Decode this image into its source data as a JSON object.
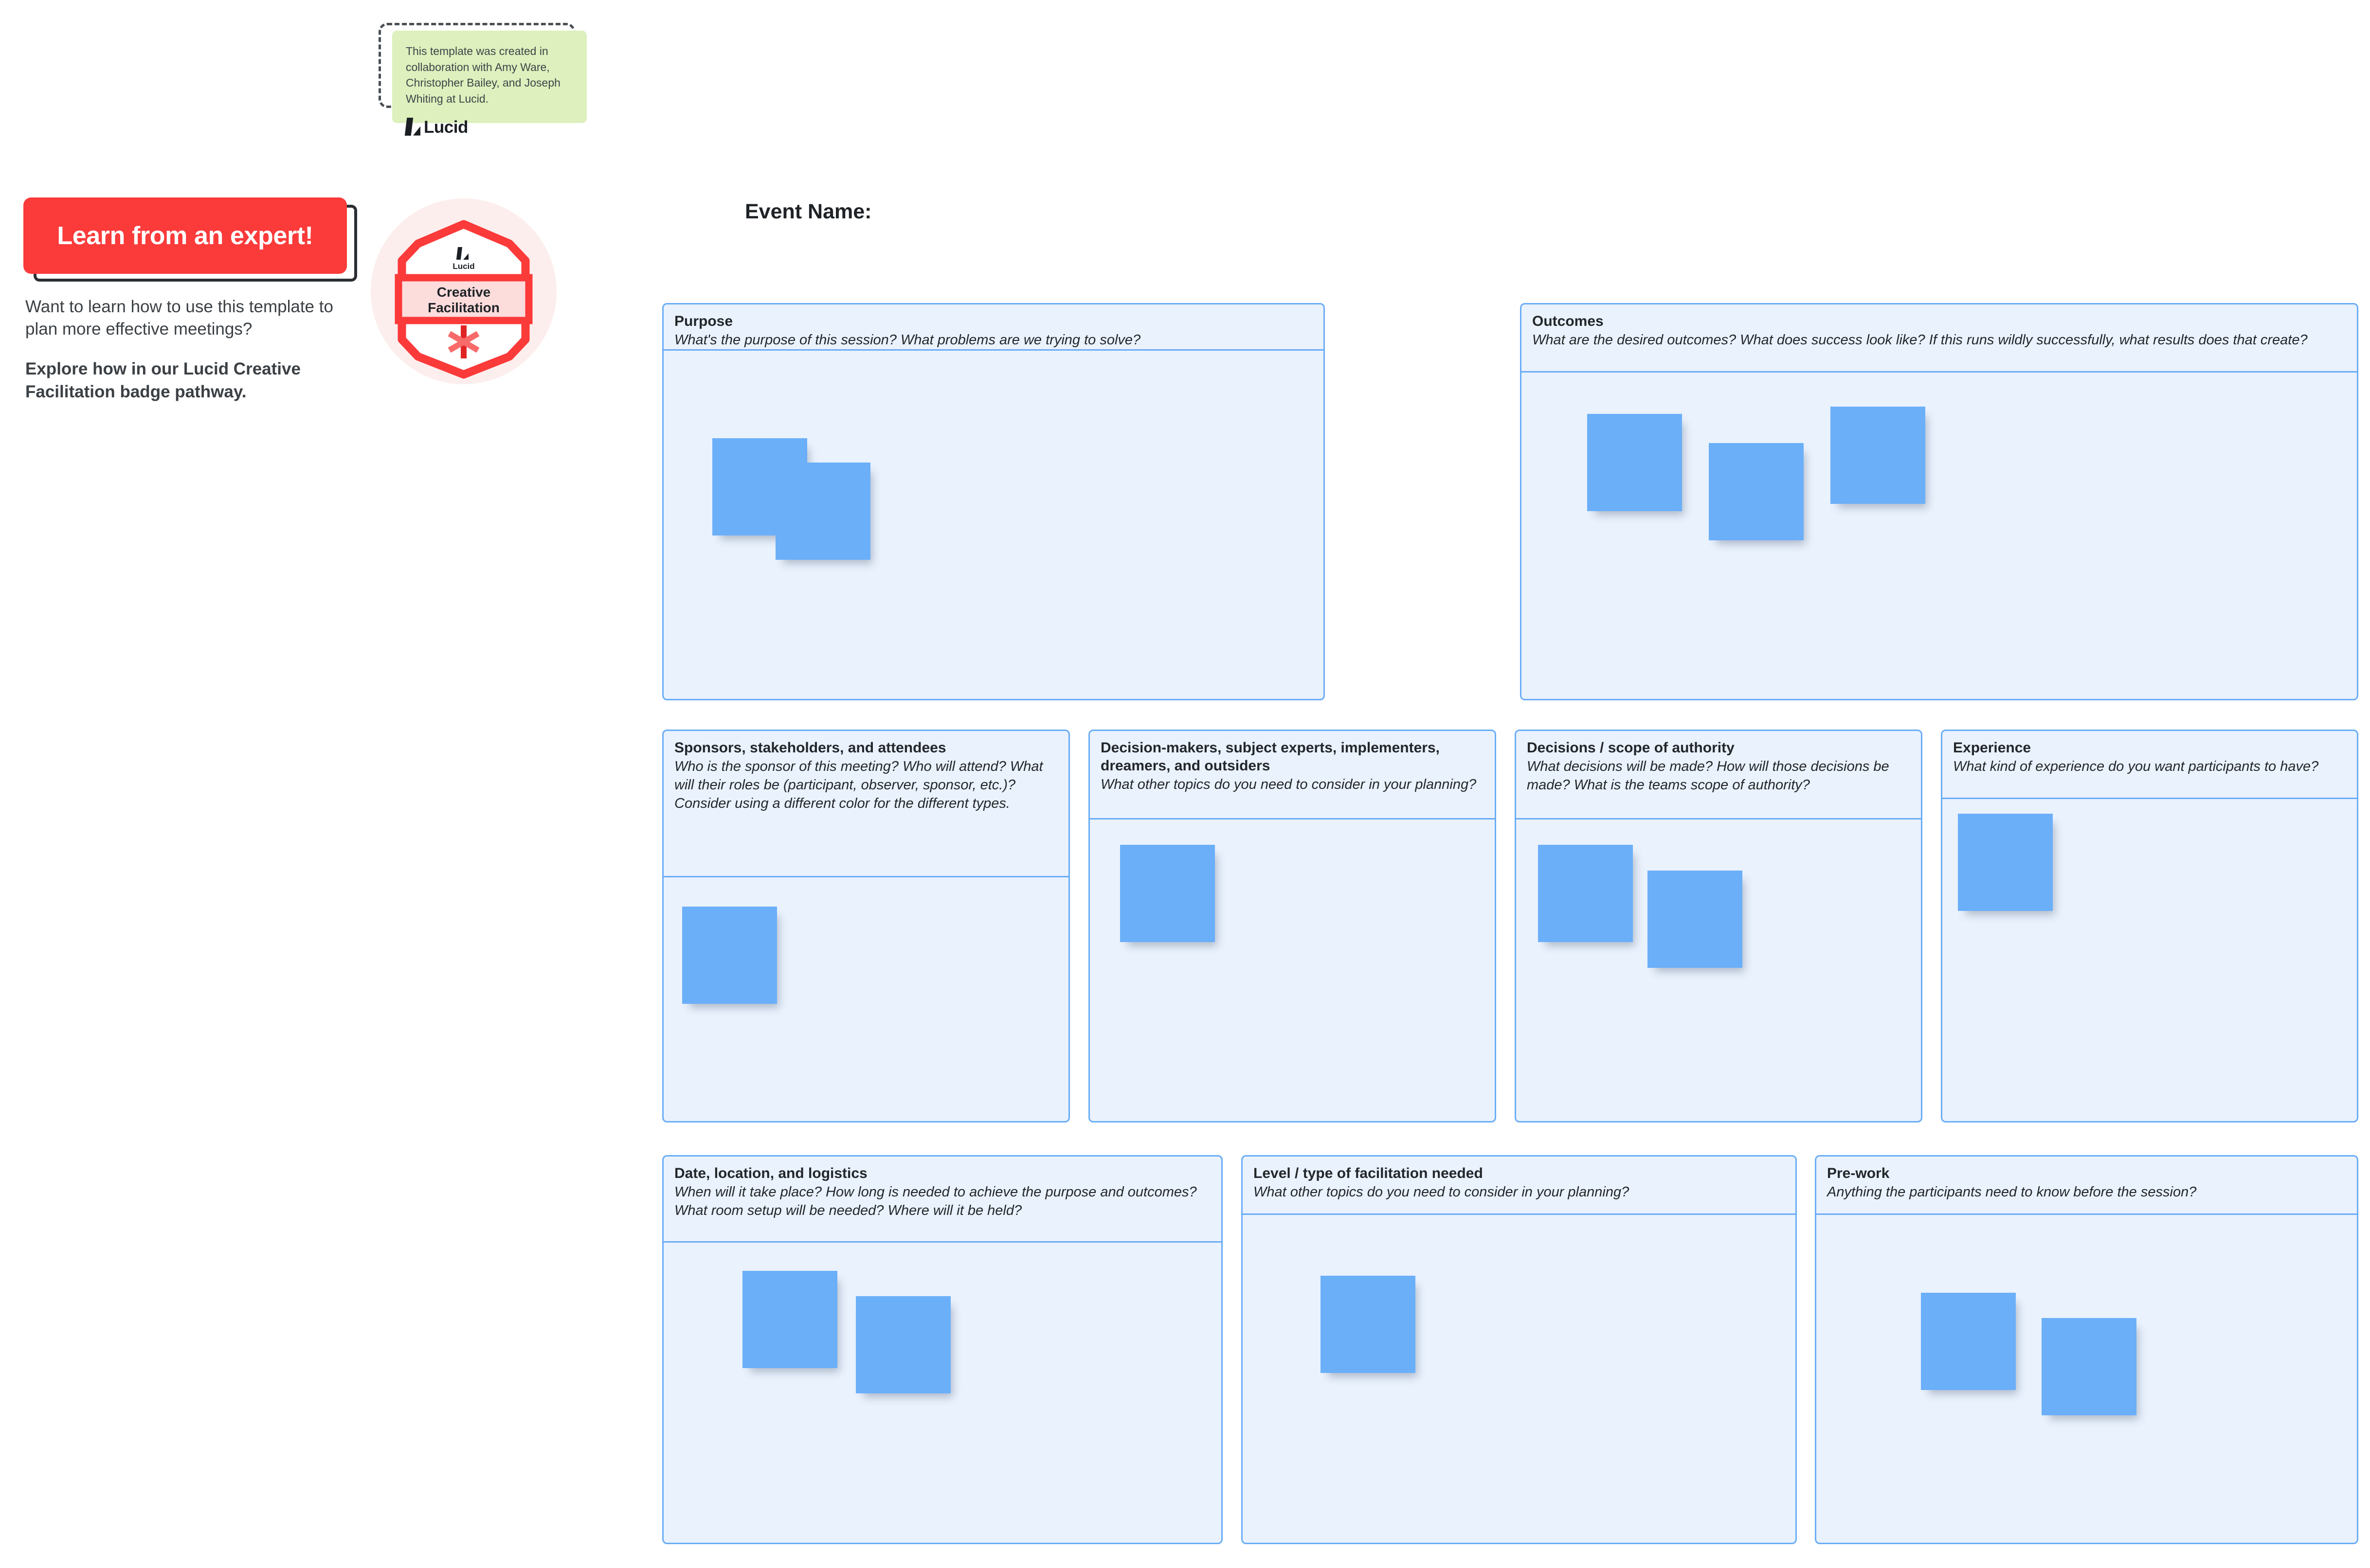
{
  "attribution": {
    "text": "This template was created in collaboration with Amy Ware, Christopher Bailey, and Joseph Whiting at Lucid.",
    "brand": "Lucid"
  },
  "promo": {
    "button_label": "Learn from an expert!",
    "paragraph": "Want to learn how to use this template to plan more effective meetings?",
    "cta": "Explore how in our Lucid Creative Facilitation badge pathway."
  },
  "badge": {
    "brand": "Lucid",
    "line1": "Creative",
    "line2": "Facilitation",
    "colors": {
      "accent": "#FB3A3A",
      "halo": "#FDEEEE",
      "band": "#FDDCDC"
    }
  },
  "board": {
    "title": "Event Name:",
    "colors": {
      "card_fill": "#EAF2FD",
      "card_border": "#6AADF7",
      "sticky": "#6BAFF9"
    },
    "cards": [
      {
        "title": "Purpose",
        "prompt": "What's the purpose of this session? What problems are we trying to solve?",
        "stickies": 2
      },
      {
        "title": "Outcomes",
        "prompt": "What are the desired outcomes? What does success look like? If this runs wildly successfully, what results does that create?",
        "stickies": 3
      },
      {
        "title": "Sponsors, stakeholders, and attendees",
        "prompt": "Who is the sponsor of this meeting? Who will attend? What will their roles be (participant, observer, sponsor, etc.)? Consider using a different color for the different types.",
        "stickies": 1
      },
      {
        "title": "Decision-makers, subject experts, implementers, dreamers, and outsiders",
        "prompt": "What other topics do you need to consider in your planning?",
        "stickies": 1
      },
      {
        "title": "Decisions / scope of authority",
        "prompt": "What decisions will be made? How will those decisions be made? What is the teams scope of authority?",
        "stickies": 2
      },
      {
        "title": "Experience",
        "prompt": "What kind of experience do you want participants to have?",
        "stickies": 1
      },
      {
        "title": "Date, location, and logistics",
        "prompt": "When will it take place? How long is needed to achieve the purpose and outcomes? What room setup will be needed? Where will it be held?",
        "stickies": 2
      },
      {
        "title": "Level / type of facilitation needed",
        "prompt": "What other topics do you need to consider in your planning?",
        "stickies": 1
      },
      {
        "title": "Pre-work",
        "prompt": "Anything the participants need to know before the session?",
        "stickies": 2
      }
    ]
  }
}
